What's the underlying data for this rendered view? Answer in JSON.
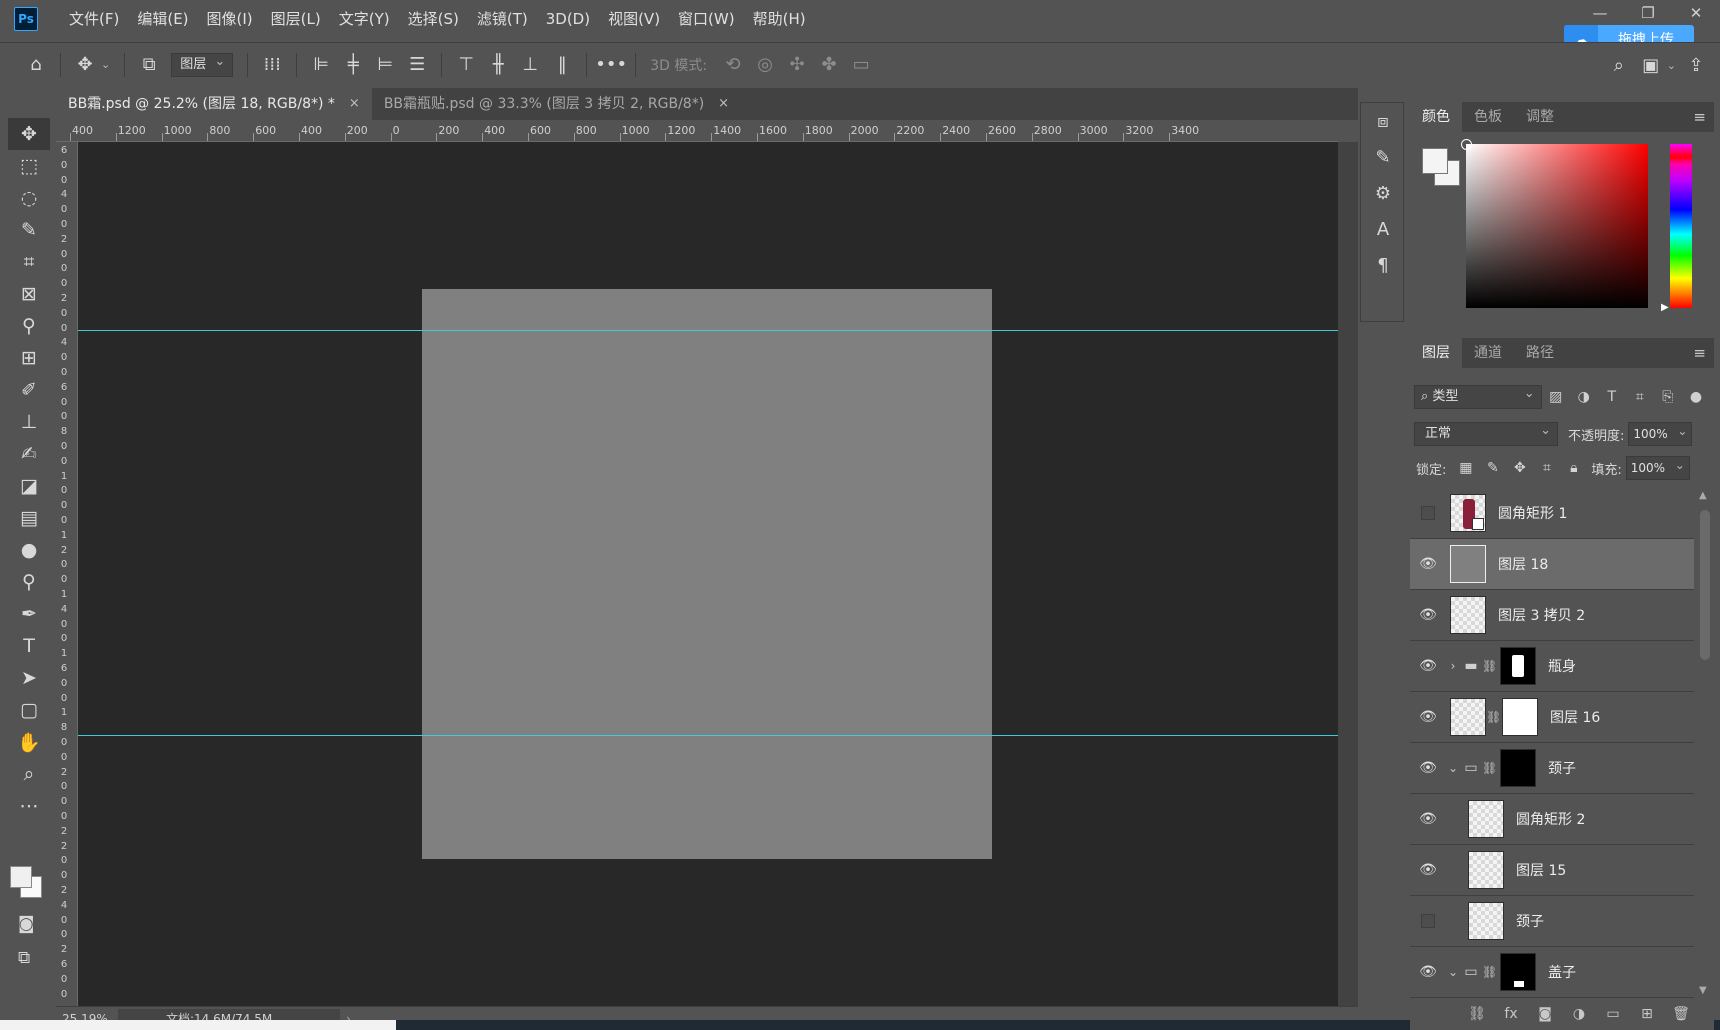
{
  "app": {
    "logo": "Ps"
  },
  "menu": [
    "文件(F)",
    "编辑(E)",
    "图像(I)",
    "图层(L)",
    "文字(Y)",
    "选择(S)",
    "滤镜(T)",
    "3D(D)",
    "视图(V)",
    "窗口(W)",
    "帮助(H)"
  ],
  "window": {
    "minimize": "—",
    "maximize": "❐",
    "close": "✕"
  },
  "upload": {
    "label": "拖拽上传"
  },
  "options": {
    "auto_select_target": "图层",
    "mode_3d_label": "3D 模式:",
    "more": "•••"
  },
  "tabs": [
    {
      "label": "BB霜.psd @ 25.2% (图层 18, RGB/8*) *",
      "close": "×"
    },
    {
      "label": "BB霜瓶贴.psd @ 33.3% (图层 3 拷贝 2, RGB/8*)",
      "close": "×"
    }
  ],
  "ruler_h": [
    "400",
    "1200",
    "1000",
    "800",
    "600",
    "400",
    "200",
    "0",
    "200",
    "400",
    "600",
    "800",
    "1000",
    "1200",
    "1400",
    "1600",
    "1800",
    "2000",
    "2200",
    "2400",
    "2600",
    "2800",
    "3000",
    "3200",
    "3400"
  ],
  "ruler_v": [
    "6",
    "0",
    "0",
    "4",
    "0",
    "0",
    "2",
    "0",
    "0",
    "0",
    "2",
    "0",
    "0",
    "4",
    "0",
    "0",
    "6",
    "0",
    "0",
    "8",
    "0",
    "0",
    "1",
    "0",
    "0",
    "0",
    "1",
    "2",
    "0",
    "0",
    "1",
    "4",
    "0",
    "0",
    "1",
    "6",
    "0",
    "0",
    "1",
    "8",
    "0",
    "0",
    "2",
    "0",
    "0",
    "0",
    "2",
    "2",
    "0",
    "0",
    "2",
    "4",
    "0",
    "0",
    "2",
    "6",
    "0",
    "0"
  ],
  "status": {
    "zoom": "25.19%",
    "doc": "文档:14.6M/74.5M",
    "arrow": "›"
  },
  "color_panel": {
    "tabs": [
      "颜色",
      "色板",
      "调整"
    ],
    "menu": "≡"
  },
  "layers_panel": {
    "tabs": [
      "图层",
      "通道",
      "路径"
    ],
    "menu": "≡",
    "filter_kind": "类型",
    "blend_mode": "正常",
    "opacity_label": "不透明度:",
    "opacity_value": "100%",
    "lock_label": "锁定:",
    "fill_label": "填充:",
    "fill_value": "100%",
    "layers": [
      {
        "name": "圆角矩形 1",
        "visible": false,
        "thumb": "red"
      },
      {
        "name": "图层 18",
        "visible": true,
        "thumb": "gray",
        "selected": true
      },
      {
        "name": "图层 3 拷贝 2",
        "visible": true,
        "thumb": "transparent"
      },
      {
        "name": "瓶身",
        "visible": true,
        "group": true,
        "expanded": false,
        "mask": "bottle"
      },
      {
        "name": "图层 16",
        "visible": true,
        "thumb": "transparent",
        "mask": "white"
      },
      {
        "name": "颈子",
        "visible": true,
        "group": true,
        "expanded": true,
        "mask": "black"
      },
      {
        "name": "圆角矩形 2",
        "visible": true,
        "thumb": "transparent",
        "child": true
      },
      {
        "name": "图层 15",
        "visible": true,
        "thumb": "transparent",
        "child": true
      },
      {
        "name": "颈子",
        "visible": false,
        "thumb": "transparent",
        "child": true
      },
      {
        "name": "盖子",
        "visible": true,
        "group": true,
        "expanded": true,
        "mask": "lid"
      }
    ]
  },
  "colors": {
    "guide": "#3fcbd8",
    "artboard": "#808080",
    "canvas_bg": "#282828",
    "accent_upload": "#4aa8ff"
  }
}
